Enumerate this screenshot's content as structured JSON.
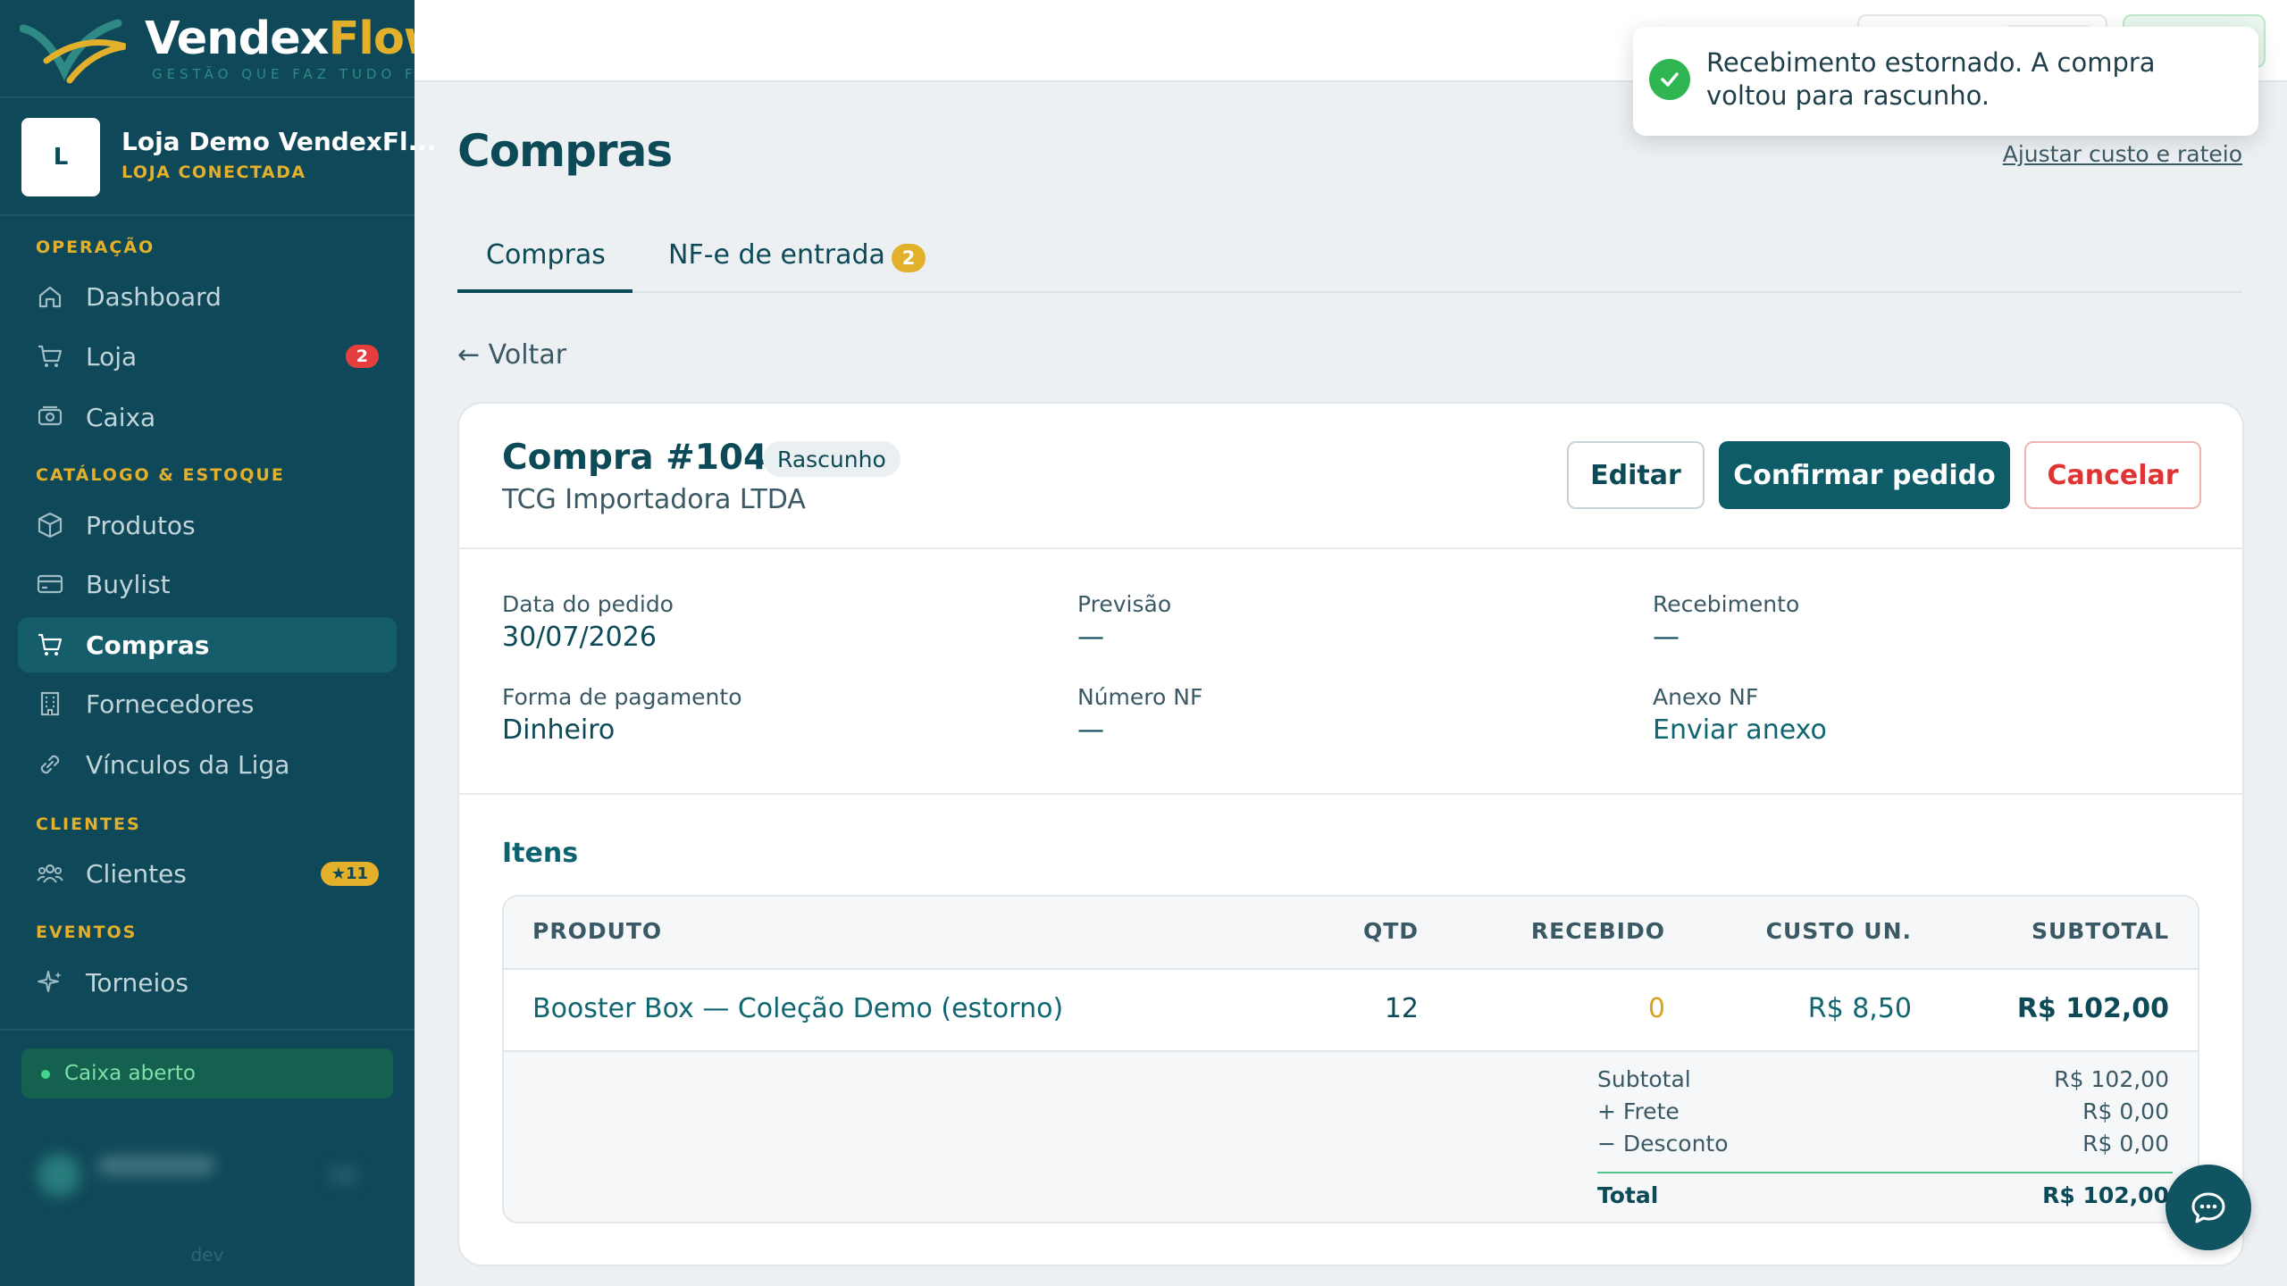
{
  "brand": {
    "name_part1": "Vendex",
    "name_part2": "Flow",
    "tagline": "GESTÃO QUE FAZ TUDO FLUIR"
  },
  "store": {
    "initial": "L",
    "name": "Loja Demo VendexFl...",
    "status": "LOJA CONECTADA"
  },
  "sidebar": {
    "sections": {
      "operacao": "OPERAÇÃO",
      "catalogo": "CATÁLOGO & ESTOQUE",
      "clientes": "CLIENTES",
      "eventos": "EVENTOS"
    },
    "items": [
      {
        "label": "Dashboard",
        "icon": "home-icon"
      },
      {
        "label": "Loja",
        "icon": "cart-icon",
        "badge": "2"
      },
      {
        "label": "Caixa",
        "icon": "cash-register-icon"
      },
      {
        "label": "Produtos",
        "icon": "box-icon"
      },
      {
        "label": "Buylist",
        "icon": "card-icon"
      },
      {
        "label": "Compras",
        "icon": "cart-icon",
        "active": true
      },
      {
        "label": "Fornecedores",
        "icon": "building-icon"
      },
      {
        "label": "Vínculos da Liga",
        "icon": "link-icon"
      },
      {
        "label": "Clientes",
        "icon": "users-icon",
        "badge": "★11"
      },
      {
        "label": "Torneios",
        "icon": "sparkle-icon"
      }
    ],
    "caixa_status": "Caixa aberto",
    "env": "dev"
  },
  "toast": {
    "message": "Recebimento estornado. A compra voltou para rascunho.",
    "icon": "check-circle-icon"
  },
  "page": {
    "title": "Compras",
    "adjust_link": "Ajustar custo e rateio",
    "tabs": [
      {
        "label": "Compras",
        "active": true
      },
      {
        "label": "NF-e de entrada",
        "badge": "2"
      }
    ],
    "back": "← Voltar"
  },
  "purchase": {
    "title": "Compra #1043",
    "status": "Rascunho",
    "supplier": "TCG Importadora LTDA",
    "actions": {
      "edit": "Editar",
      "confirm": "Confirmar pedido",
      "cancel": "Cancelar"
    },
    "fields": {
      "data_pedido": {
        "label": "Data do pedido",
        "value": "30/07/2026"
      },
      "previsao": {
        "label": "Previsão",
        "value": "—"
      },
      "recebimento": {
        "label": "Recebimento",
        "value": "—"
      },
      "forma_pagamento": {
        "label": "Forma de pagamento",
        "value": "Dinheiro"
      },
      "numero_nf": {
        "label": "Número NF",
        "value": "—"
      },
      "anexo_nf": {
        "label": "Anexo NF",
        "value": "Enviar anexo"
      }
    },
    "items_title": "Itens",
    "table": {
      "headers": {
        "produto": "PRODUTO",
        "qtd": "QTD",
        "recebido": "RECEBIDO",
        "custo": "CUSTO UN.",
        "subtotal": "SUBTOTAL"
      },
      "rows": [
        {
          "produto": "Booster Box — Coleção Demo (estorno)",
          "qtd": "12",
          "recebido": "0",
          "custo": "R$ 8,50",
          "subtotal": "R$ 102,00"
        }
      ]
    },
    "summary": {
      "subtotal_label": "Subtotal",
      "subtotal": "R$ 102,00",
      "frete_label": "+ Frete",
      "frete": "R$ 0,00",
      "desconto_label": "− Desconto",
      "desconto": "R$ 0,00",
      "total_label": "Total",
      "total": "R$ 102,00"
    }
  },
  "colors": {
    "sidebar": "#0f4858",
    "accent": "#e3b02b",
    "primary": "#0f5c69",
    "danger": "#e03434"
  }
}
